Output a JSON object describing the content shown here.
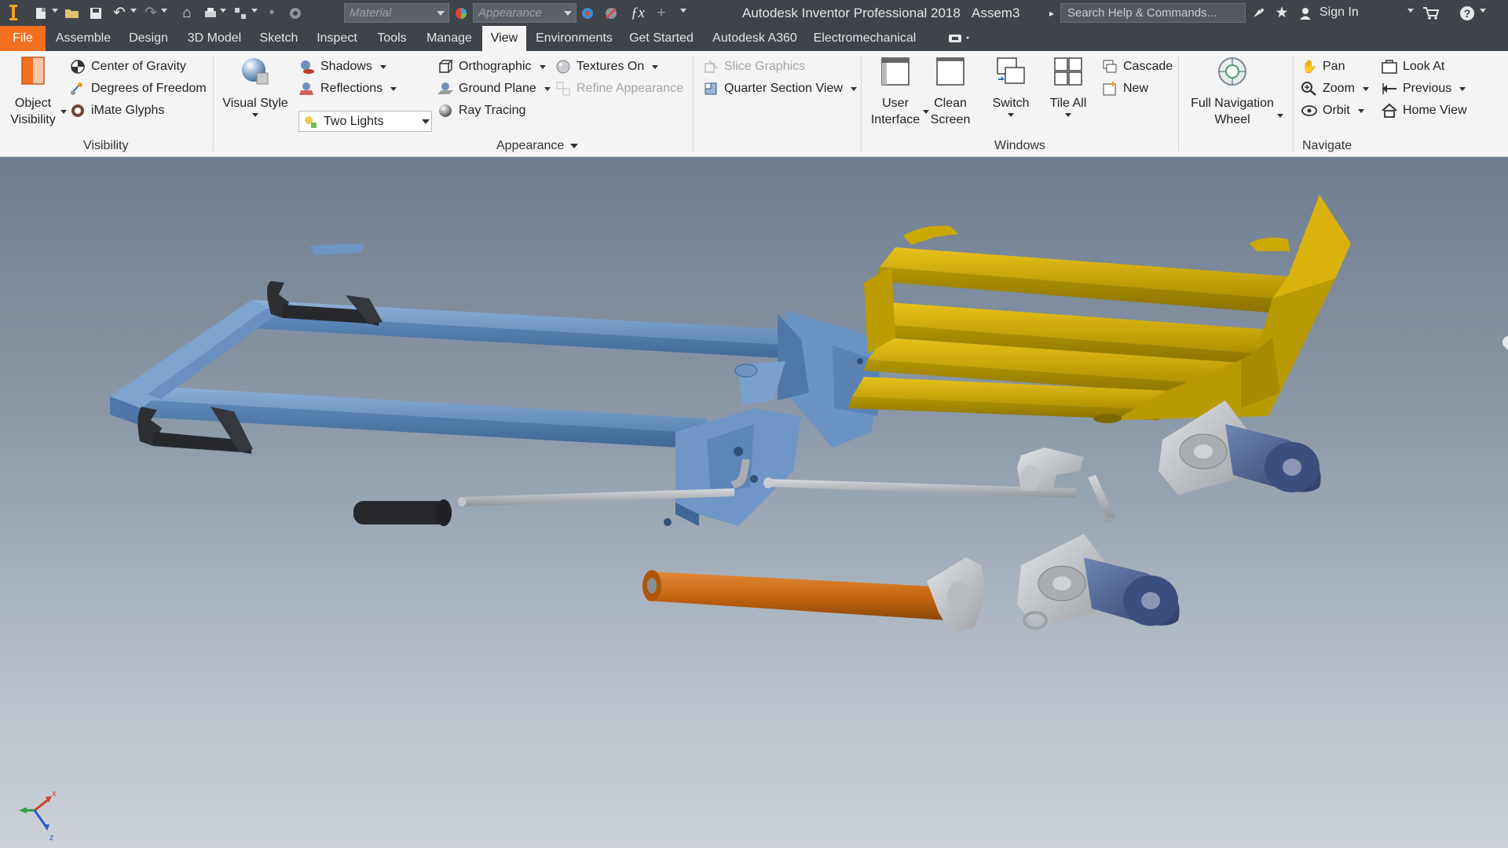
{
  "titlebar": {
    "app_title": "Autodesk Inventor Professional 2018",
    "document": "Assem3",
    "material_placeholder": "Material",
    "appearance_placeholder": "Appearance",
    "search_placeholder": "Search Help & Commands...",
    "sign_in": "Sign In"
  },
  "tabs": [
    {
      "label": "File"
    },
    {
      "label": "Assemble"
    },
    {
      "label": "Design"
    },
    {
      "label": "3D Model"
    },
    {
      "label": "Sketch"
    },
    {
      "label": "Inspect"
    },
    {
      "label": "Tools"
    },
    {
      "label": "Manage"
    },
    {
      "label": "View"
    },
    {
      "label": "Environments"
    },
    {
      "label": "Get Started"
    },
    {
      "label": "Autodesk A360"
    },
    {
      "label": "Electromechanical"
    }
  ],
  "active_tab": "View",
  "ribbon": {
    "visibility": {
      "title": "Visibility",
      "object_visibility_1": "Object",
      "object_visibility_2": "Visibility",
      "center_of_gravity": "Center of Gravity",
      "degrees_of_freedom": "Degrees of Freedom",
      "imate_glyphs": "iMate Glyphs"
    },
    "appearance": {
      "title": "Appearance",
      "visual_style": "Visual Style",
      "shadows": "Shadows",
      "reflections": "Reflections",
      "lighting": "Two Lights",
      "orthographic": "Orthographic",
      "ground_plane": "Ground Plane",
      "ray_tracing": "Ray Tracing",
      "textures_on": "Textures On",
      "refine_appearance": "Refine Appearance",
      "slice_graphics": "Slice Graphics",
      "quarter_section_view": "Quarter Section View"
    },
    "windows": {
      "title": "Windows",
      "user_interface_1": "User",
      "user_interface_2": "Interface",
      "clean_screen_1": "Clean",
      "clean_screen_2": "Screen",
      "switch": "Switch",
      "tile_all": "Tile All",
      "cascade": "Cascade",
      "new": "New"
    },
    "navigate": {
      "title": "Navigate",
      "full_nav_wheel_1": "Full Navigation",
      "full_nav_wheel_2": "Wheel",
      "pan": "Pan",
      "zoom": "Zoom",
      "orbit": "Orbit",
      "look_at": "Look At",
      "previous": "Previous",
      "home_view": "Home View"
    }
  },
  "viewport": {
    "triad_x": "x",
    "triad_z": "z"
  },
  "colors": {
    "file_tab": "#f37021",
    "frame_blue": "#5b87b8",
    "fork_yellow": "#c9a800",
    "roller_orange": "#c7660f",
    "handle_dark": "#2d2f33"
  },
  "icons": [
    "application-icon",
    "new-icon",
    "open-icon",
    "save-icon",
    "undo-icon",
    "redo-icon",
    "home-icon",
    "help-icon",
    "cart-icon",
    "user-icon"
  ]
}
